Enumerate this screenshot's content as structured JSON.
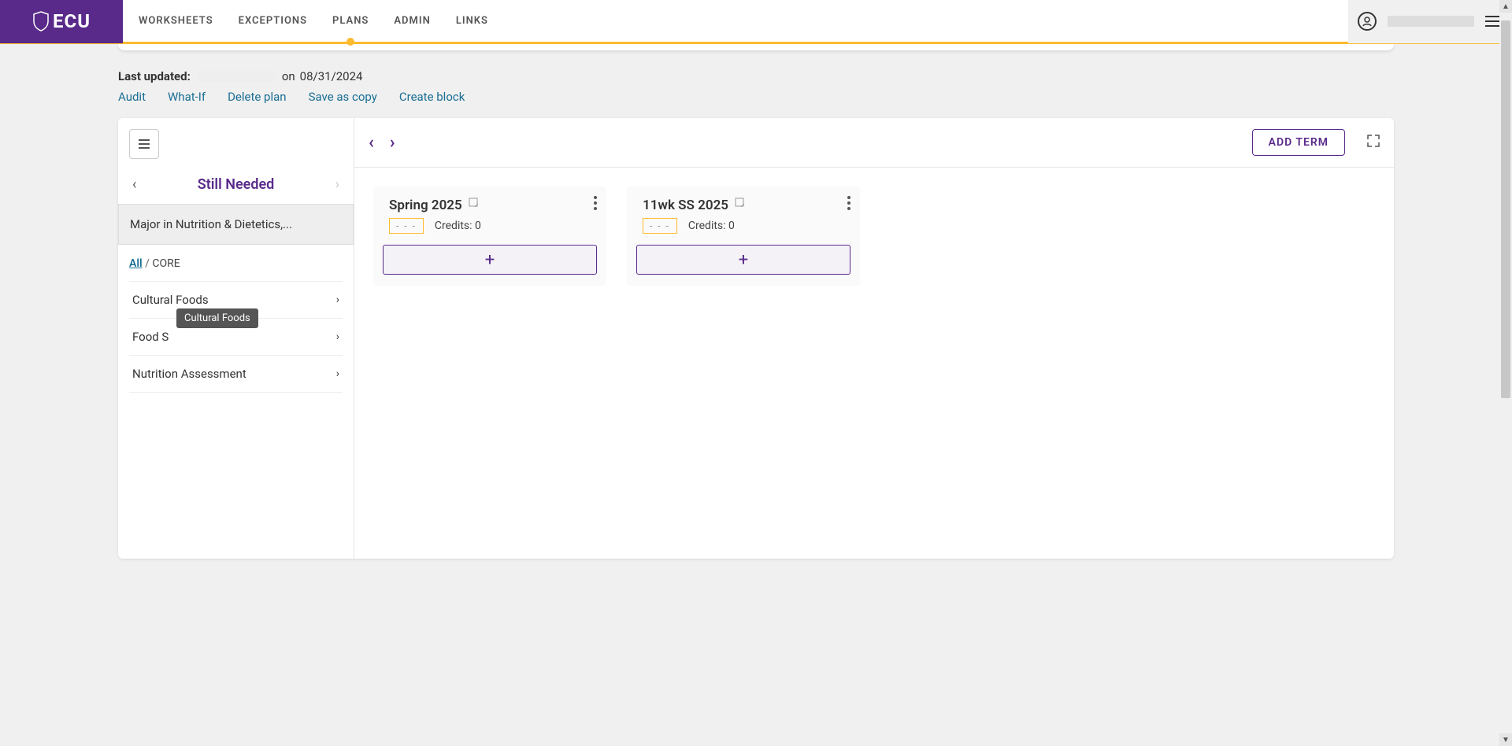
{
  "brand": "ECU",
  "nav": {
    "items": [
      "WORKSHEETS",
      "EXCEPTIONS",
      "PLANS",
      "ADMIN",
      "LINKS"
    ],
    "active_index": 2
  },
  "meta": {
    "label": "Last updated:",
    "on_word": "on",
    "date": "08/31/2024"
  },
  "action_links": [
    "Audit",
    "What-If",
    "Delete plan",
    "Save as copy",
    "Create block"
  ],
  "sidebar": {
    "title": "Still Needed",
    "major": "Major in Nutrition & Dietetics,...",
    "filter": {
      "all": "All",
      "sep": "/",
      "core": "CORE"
    },
    "requirements": [
      {
        "label": "Cultural Foods"
      },
      {
        "label": "Food S"
      },
      {
        "label": "Nutrition Assessment"
      }
    ],
    "tooltip": "Cultural Foods"
  },
  "right": {
    "add_term": "ADD TERM",
    "terms": [
      {
        "title": "Spring 2025",
        "credits_label": "Credits:",
        "credits_value": "0",
        "dash": "- - -"
      },
      {
        "title": "11wk SS 2025",
        "credits_label": "Credits:",
        "credits_value": "0",
        "dash": "- - -"
      }
    ]
  }
}
